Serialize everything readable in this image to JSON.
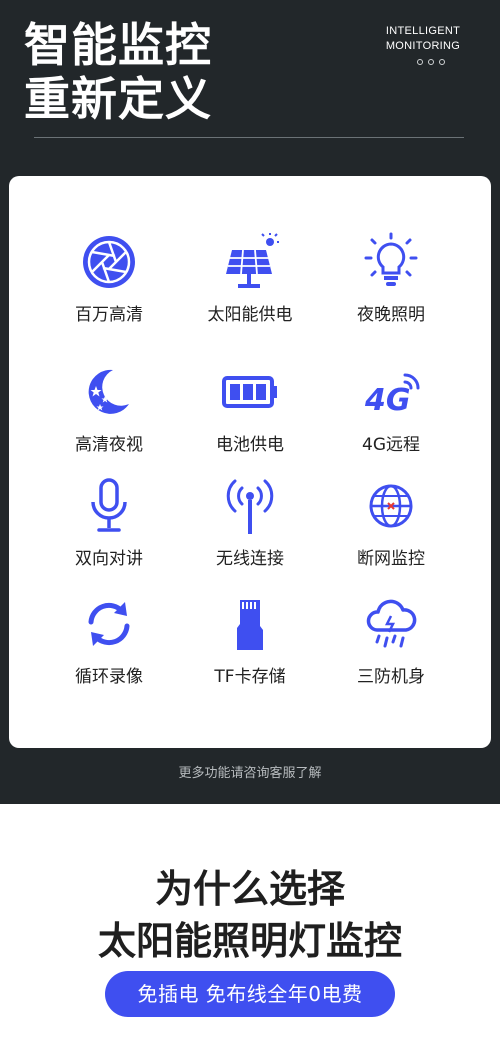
{
  "header": {
    "title_line1": "智能监控",
    "title_line2": "重新定义",
    "en_line1": "INTELLIGENT",
    "en_line2": "MONITORING"
  },
  "features": [
    {
      "label": "百万高清",
      "icon": "camera-aperture-icon"
    },
    {
      "label": "太阳能供电",
      "icon": "solar-panel-icon"
    },
    {
      "label": "夜晚照明",
      "icon": "light-bulb-icon"
    },
    {
      "label": "高清夜视",
      "icon": "moon-stars-icon"
    },
    {
      "label": "电池供电",
      "icon": "battery-icon"
    },
    {
      "label": "4G远程",
      "icon": "4g-signal-icon"
    },
    {
      "label": "双向对讲",
      "icon": "microphone-icon"
    },
    {
      "label": "无线连接",
      "icon": "antenna-icon"
    },
    {
      "label": "断网监控",
      "icon": "globe-icon"
    },
    {
      "label": "循环录像",
      "icon": "loop-arrows-icon"
    },
    {
      "label": "TF卡存储",
      "icon": "sd-card-icon"
    },
    {
      "label": "三防机身",
      "icon": "rain-cloud-icon"
    }
  ],
  "note": "更多功能请咨询客服了解",
  "why": {
    "line1": "为什么选择",
    "line2": "太阳能照明灯监控"
  },
  "pill": "免插电 免布线全年0电费",
  "colors": {
    "dark_bg": "#22272a",
    "accent_blue": "#3f4ff0"
  }
}
